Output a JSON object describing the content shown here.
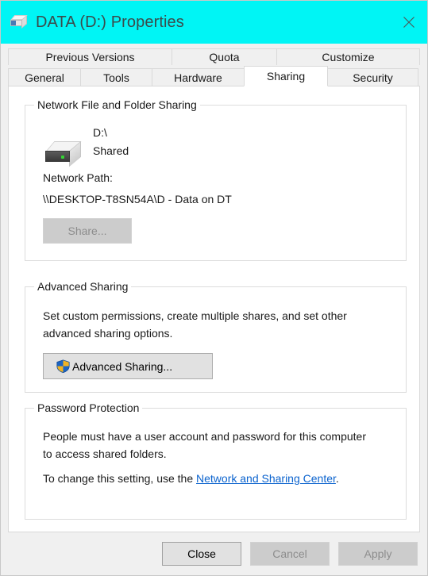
{
  "window": {
    "title": "DATA (D:) Properties",
    "titlebar_color": "#00f5f5",
    "icon": "drive-icon",
    "close_label": "Close window"
  },
  "tabs": {
    "row1": [
      {
        "label": "Previous Versions",
        "selected": false
      },
      {
        "label": "Quota",
        "selected": false
      },
      {
        "label": "Customize",
        "selected": false
      }
    ],
    "row2": [
      {
        "label": "General",
        "selected": false
      },
      {
        "label": "Tools",
        "selected": false
      },
      {
        "label": "Hardware",
        "selected": false
      },
      {
        "label": "Sharing",
        "selected": true
      },
      {
        "label": "Security",
        "selected": false
      }
    ]
  },
  "sharing_page": {
    "network_sharing": {
      "group_title": "Network File and Folder Sharing",
      "share_name": "D:\\",
      "share_state": "Shared",
      "network_path_label": "Network Path:",
      "network_path_value": "\\\\DESKTOP-T8SN54A\\D - Data on DT",
      "share_button": "Share...",
      "share_button_enabled": false
    },
    "advanced_sharing": {
      "group_title": "Advanced Sharing",
      "description": "Set custom permissions, create multiple shares, and set other advanced sharing options.",
      "button_label": "Advanced Sharing...",
      "button_icon": "uac-shield-icon",
      "button_enabled": true
    },
    "password_protection": {
      "group_title": "Password Protection",
      "description": "People must have a user account and password for this computer to access shared folders.",
      "setting_prefix": "To change this setting, use the ",
      "link_text": "Network and Sharing Center",
      "setting_suffix": "."
    }
  },
  "footer": {
    "close": {
      "label": "Close",
      "enabled": true,
      "default": true
    },
    "cancel": {
      "label": "Cancel",
      "enabled": false
    },
    "apply": {
      "label": "Apply",
      "enabled": false
    }
  },
  "colors": {
    "titlebar": "#00f5f5",
    "link": "#0b63ce",
    "dialog_bg": "#f0f0f0",
    "page_bg": "#ffffff",
    "led_green": "#35d435",
    "shield_blue": "#1b64c4",
    "shield_yellow": "#f0b323"
  }
}
